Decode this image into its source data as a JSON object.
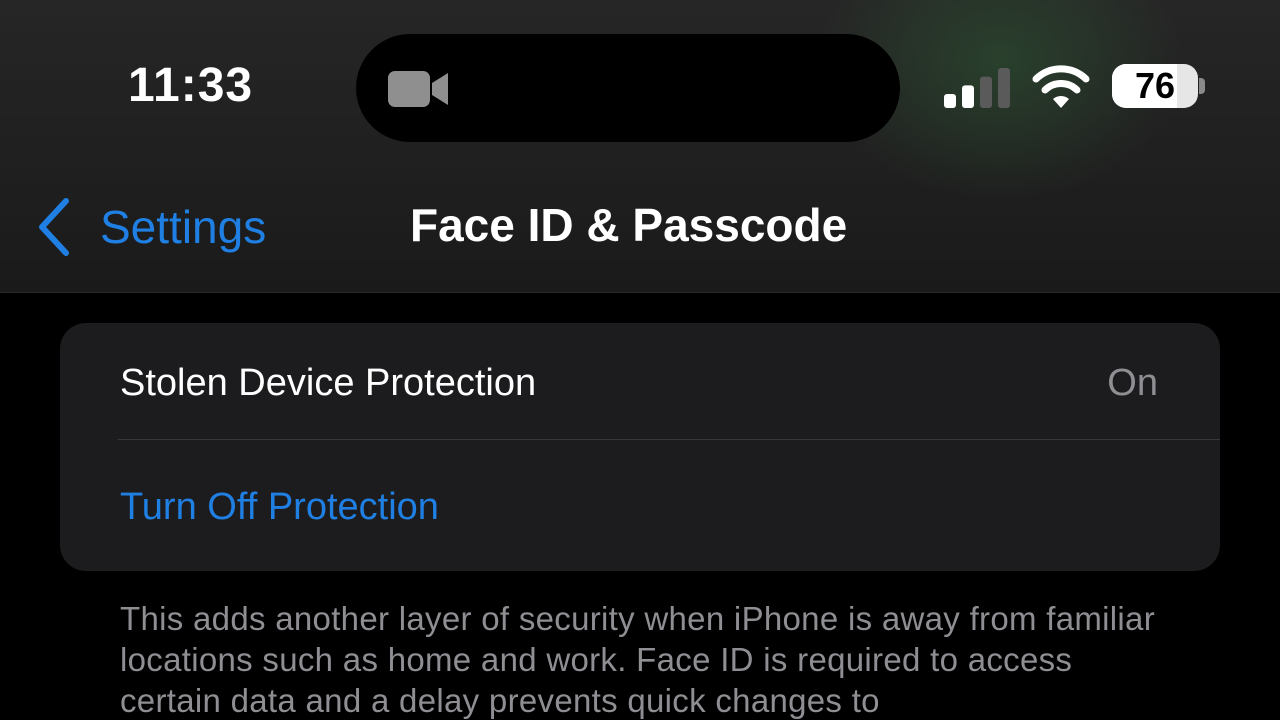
{
  "status_bar": {
    "time": "11:33",
    "battery_level": "76",
    "battery_fraction": 0.76,
    "signal_bars_active": 2,
    "signal_bars_total": 4,
    "icons": [
      "video-camera-icon",
      "cellular-signal-icon",
      "wifi-icon",
      "battery-icon"
    ]
  },
  "nav": {
    "back_label": "Settings",
    "title": "Face ID & Passcode"
  },
  "group": {
    "row_label": "Stolen Device Protection",
    "row_value": "On",
    "action_label": "Turn Off Protection"
  },
  "footer": {
    "text": "This adds another layer of security when iPhone is away from familiar locations such as home and work. Face ID is required to access certain data and a delay prevents quick changes to"
  },
  "colors": {
    "accent": "#1f7fe3",
    "secondary_text": "#8e8e93",
    "group_background": "#1c1c1e",
    "page_background": "#000000"
  }
}
